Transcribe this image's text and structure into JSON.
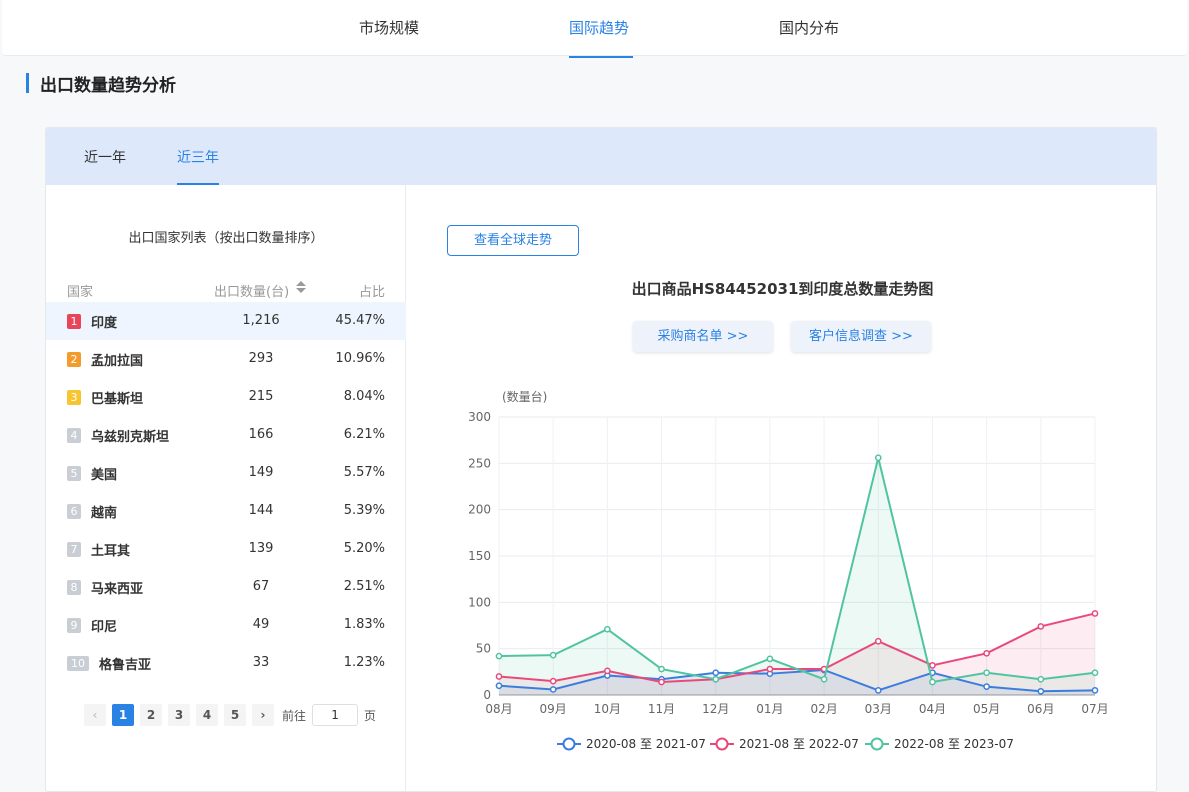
{
  "nav": {
    "tabs": [
      "市场规模",
      "国际趋势",
      "国内分布"
    ],
    "active": 1
  },
  "section_title": "出口数量趋势分析",
  "period_tabs": {
    "tabs": [
      "近一年",
      "近三年"
    ],
    "active": 1
  },
  "list": {
    "title": "出口国家列表（按出口数量排序）",
    "headers": {
      "country": "国家",
      "qty": "出口数量(台)",
      "pct": "占比"
    },
    "rows": [
      {
        "rank": "1",
        "name": "印度",
        "qty": "1,216",
        "pct": "45.47%"
      },
      {
        "rank": "2",
        "name": "孟加拉国",
        "qty": "293",
        "pct": "10.96%"
      },
      {
        "rank": "3",
        "name": "巴基斯坦",
        "qty": "215",
        "pct": "8.04%"
      },
      {
        "rank": "4",
        "name": "乌兹别克斯坦",
        "qty": "166",
        "pct": "6.21%"
      },
      {
        "rank": "5",
        "name": "美国",
        "qty": "149",
        "pct": "5.57%"
      },
      {
        "rank": "6",
        "name": "越南",
        "qty": "144",
        "pct": "5.39%"
      },
      {
        "rank": "7",
        "name": "土耳其",
        "qty": "139",
        "pct": "5.20%"
      },
      {
        "rank": "8",
        "name": "马来西亚",
        "qty": "67",
        "pct": "2.51%"
      },
      {
        "rank": "9",
        "name": "印尼",
        "qty": "49",
        "pct": "1.83%"
      },
      {
        "rank": "10",
        "name": "格鲁吉亚",
        "qty": "33",
        "pct": "1.23%"
      }
    ],
    "rank_colors": [
      "#e8445a",
      "#f39c2d",
      "#f7c530",
      "#c9cdd4",
      "#c9cdd4",
      "#c9cdd4",
      "#c9cdd4",
      "#c9cdd4",
      "#c9cdd4",
      "#c9cdd4"
    ]
  },
  "pager": {
    "pages": [
      "1",
      "2",
      "3",
      "4",
      "5"
    ],
    "current": "1",
    "goto_label": "前往",
    "page_suffix": "页",
    "input_value": "1",
    "prev_icon": "chevron-left-icon",
    "next_icon": "chevron-right-icon"
  },
  "global_button": "查看全球走势",
  "chart_title": "出口商品HS84452031到印度总数量走势图",
  "buyer_button": "采购商名单 >>",
  "customer_button": "客户信息调查 >>",
  "chart_data": {
    "type": "line",
    "ylabel": "(数量台)",
    "ylim": [
      0,
      300
    ],
    "yticks": [
      0,
      50,
      100,
      150,
      200,
      250,
      300
    ],
    "categories": [
      "08月",
      "09月",
      "10月",
      "11月",
      "12月",
      "01月",
      "02月",
      "03月",
      "04月",
      "05月",
      "06月",
      "07月"
    ],
    "grid": true,
    "legend_position": "bottom",
    "series": [
      {
        "name": "2020-08 至 2021-07",
        "color": "#3b7ddd",
        "values": [
          10,
          6,
          21,
          17,
          24,
          23,
          27,
          5,
          24,
          9,
          4,
          5
        ]
      },
      {
        "name": "2021-08 至 2022-07",
        "color": "#e8497a",
        "values": [
          20,
          15,
          26,
          14,
          17,
          28,
          28,
          58,
          32,
          45,
          74,
          88
        ]
      },
      {
        "name": "2022-08 至 2023-07",
        "color": "#50c4a0",
        "values": [
          42,
          43,
          71,
          28,
          17,
          39,
          17,
          256,
          14,
          24,
          17,
          24
        ]
      }
    ]
  }
}
